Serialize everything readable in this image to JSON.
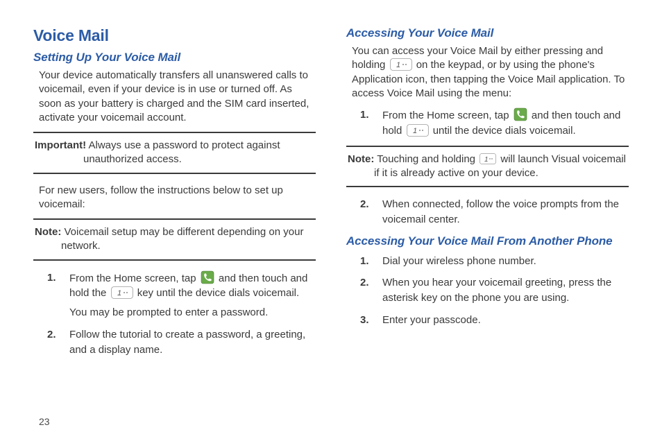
{
  "left": {
    "h1": "Voice Mail",
    "h2a": "Setting Up Your Voice Mail",
    "p1": "Your device automatically transfers all unanswered calls to voicemail, even if your device is in use or turned off. As soon as your battery is charged and the SIM card inserted, activate your voicemail account.",
    "important_lead": "Important!",
    "important_line1": " Always use a password to protect against",
    "important_line2": "unauthorized access.",
    "p2": "For new users, follow the instructions below to set up voicemail:",
    "note_lead": "Note:",
    "note_line1": " Voicemail setup may be different depending on your",
    "note_line2": "network.",
    "step1_a": "From the Home screen, tap ",
    "step1_b": " and then touch and hold the ",
    "step1_c": " key until the device dials voicemail.",
    "step1_extra": "You may be prompted to enter a password.",
    "step2": "Follow the tutorial to create a password, a greeting, and a display name.",
    "num1": "1.",
    "num2": "2."
  },
  "right": {
    "h2a": "Accessing Your Voice Mail",
    "p1_a": "You can access your Voice Mail by either pressing and holding ",
    "p1_b": " on the keypad, or by using the phone's Application icon, then tapping the Voice Mail application. To access Voice Mail using the menu:",
    "step1_a": "From the Home screen, tap ",
    "step1_b": " and then touch and hold ",
    "step1_c": " until the device dials voicemail.",
    "note_lead": "Note:",
    "note_line1": " Touching and holding ",
    "note_line2": " will launch Visual voicemail",
    "note_line3": "if it is already active on your device.",
    "step2": "When connected, follow the voice prompts from the voicemail center.",
    "h2b": "Accessing Your Voice Mail From Another Phone",
    "b_step1": "Dial your wireless phone number.",
    "b_step2": "When you hear your voicemail greeting, press the asterisk key on the phone you are using.",
    "b_step3": "Enter your passcode.",
    "num1": "1.",
    "num2": "2.",
    "num3": "3."
  },
  "page_number": "23"
}
